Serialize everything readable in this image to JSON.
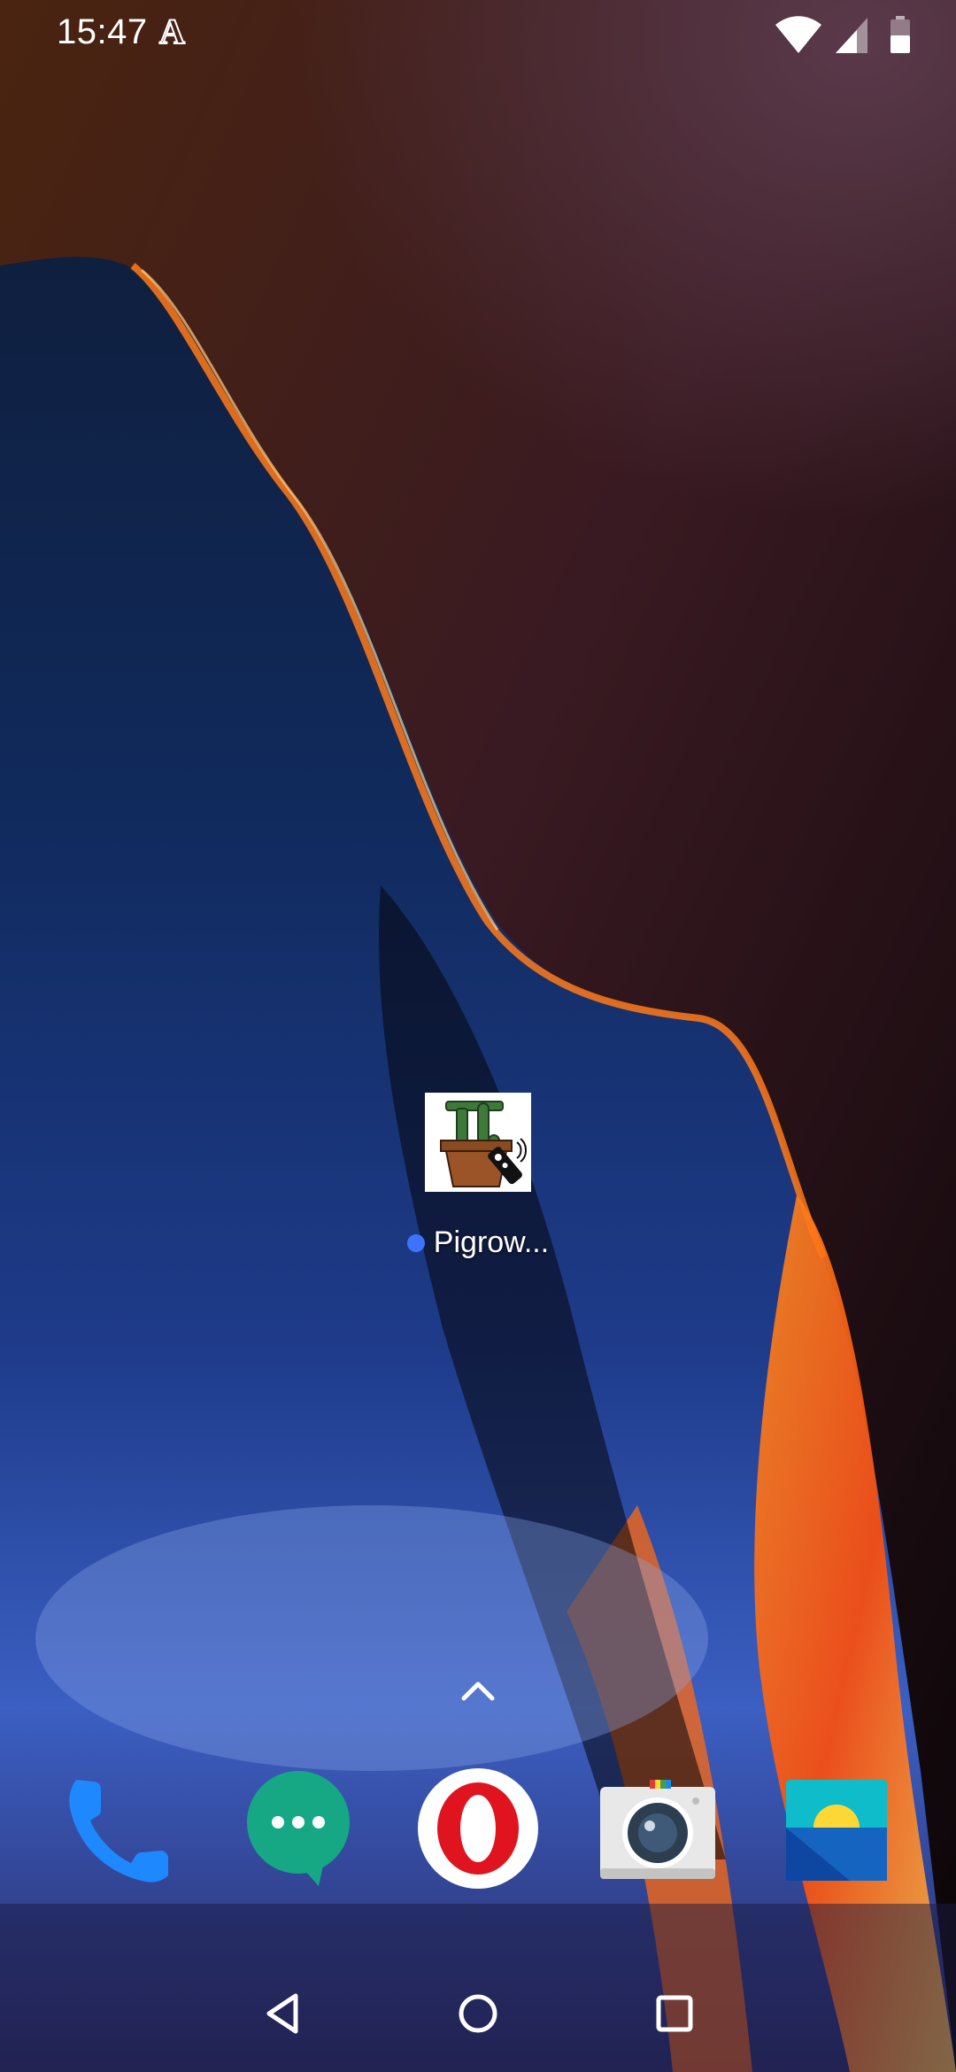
{
  "status_bar": {
    "time": "15:47",
    "notification_icon": "A",
    "icons": [
      "wifi-icon",
      "cell-signal-icon",
      "battery-icon"
    ]
  },
  "desktop": {
    "app": {
      "label": "Pigrow...",
      "icon": "pigrow-remote-icon",
      "new_indicator_color": "#3d73ff"
    },
    "drawer_handle_icon": "chevron-up-icon"
  },
  "dock": {
    "apps": [
      {
        "icon": "phone-icon",
        "color": "#1e88ff"
      },
      {
        "icon": "messages-icon",
        "color": "#16a884"
      },
      {
        "icon": "opera-browser-icon",
        "color": "#e0141e"
      },
      {
        "icon": "camera-icon",
        "color": "#2c3e50"
      },
      {
        "icon": "gallery-icon",
        "color": "#0fbcc9"
      }
    ]
  },
  "nav_bar": {
    "buttons": [
      "back-icon",
      "home-icon",
      "recents-icon"
    ]
  }
}
